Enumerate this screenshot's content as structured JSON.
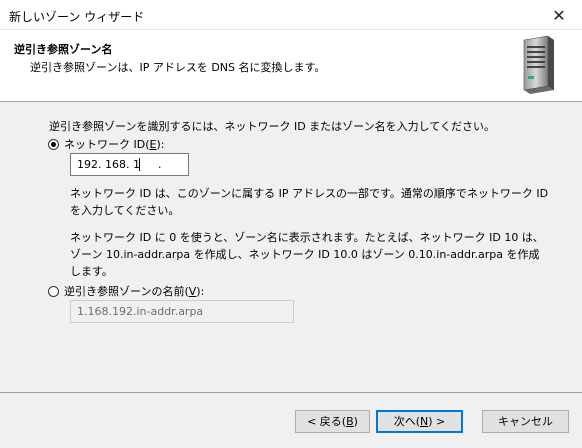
{
  "window": {
    "title": "新しいゾーン ウィザード",
    "close_glyph": "✕"
  },
  "header": {
    "title": "逆引き参照ゾーン名",
    "subtitle": "逆引き参照ゾーンは、IP アドレスを DNS 名に変換します。"
  },
  "main": {
    "instruction": "逆引き参照ゾーンを識別するには、ネットワーク ID またはゾーン名を入力してください。",
    "network_id_option": {
      "label": "ネットワーク ID(",
      "accel": "E",
      "label_end": "):",
      "selected": true,
      "octets": [
        "192",
        "168",
        "1",
        ""
      ],
      "dot": "."
    },
    "description_1": "ネットワーク ID は、このゾーンに属する IP アドレスの一部です。通常の順序でネットワーク ID を入力してください。",
    "description_2": "ネットワーク ID に 0 を使うと、ゾーン名に表示されます。たとえば、ネットワーク ID 10 は、ゾーン 10.in-addr.arpa を作成し、ネットワーク ID 10.0 はゾーン 0.10.in-addr.arpa を作成します。",
    "zone_name_option": {
      "label": "逆引き参照ゾーンの名前(",
      "accel": "V",
      "label_end": "):",
      "selected": false,
      "value": "1.168.192.in-addr.arpa"
    }
  },
  "footer": {
    "back": {
      "label": "< 戻る(",
      "accel": "B",
      "end": ")"
    },
    "next": {
      "label": "次へ(",
      "accel": "N",
      "end": ") >"
    },
    "cancel": "キャンセル"
  },
  "icons": {
    "server": "server-icon",
    "close": "close-icon"
  }
}
